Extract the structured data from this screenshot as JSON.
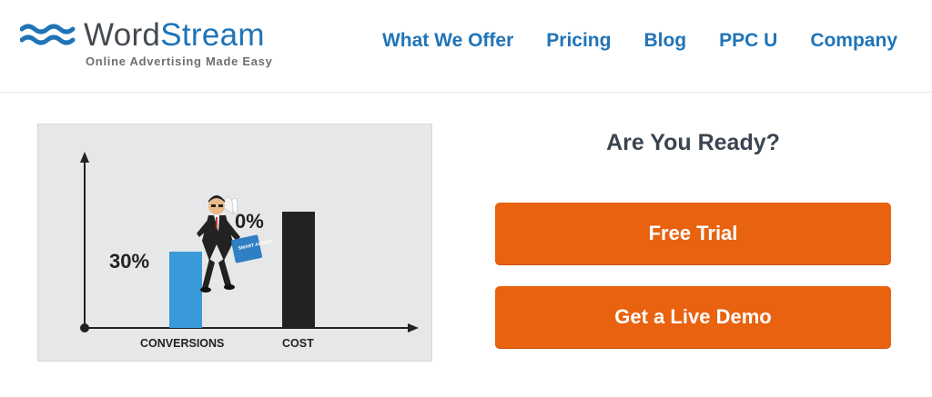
{
  "brand": {
    "name_part1": "Word",
    "name_part2": "Stream",
    "tagline": "Online Advertising Made Easy"
  },
  "nav": {
    "items": [
      {
        "label": "What We Offer"
      },
      {
        "label": "Pricing"
      },
      {
        "label": "Blog"
      },
      {
        "label": "PPC U"
      },
      {
        "label": "Company"
      }
    ]
  },
  "illustration": {
    "left_value": "30%",
    "right_value": "0%",
    "bar_label_1": "CONVERSIONS",
    "bar_label_2": "COST",
    "briefcase_text": "SMART ALERTS"
  },
  "cta": {
    "heading": "Are You Ready?",
    "trial_label": "Free Trial",
    "demo_label": "Get a Live Demo"
  },
  "colors": {
    "brand_blue": "#1f74b8",
    "cta_orange": "#e8620f",
    "bar_blue": "#3a9ad9",
    "bar_dark": "#222222"
  }
}
